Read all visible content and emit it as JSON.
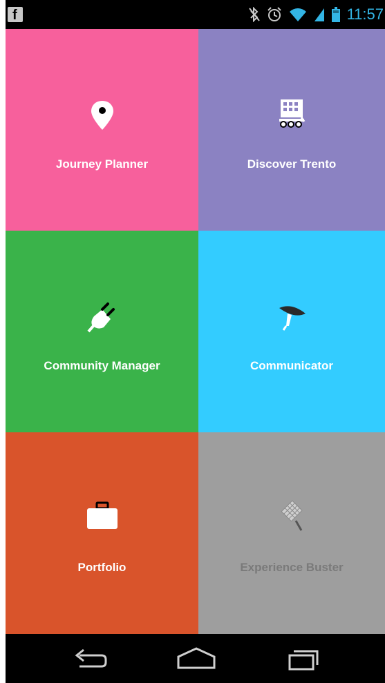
{
  "status_bar": {
    "notification_icon": "facebook-icon",
    "notification_glyph": "f",
    "icons": [
      "bluetooth-off-icon",
      "alarm-icon",
      "wifi-icon",
      "cell-signal-icon",
      "battery-icon"
    ],
    "time": "11:57",
    "accent_color": "#33b5e5"
  },
  "tiles": [
    {
      "label": "Journey Planner",
      "color": "#f7609c",
      "icon": "map-pin-icon",
      "enabled": true
    },
    {
      "label": "Discover Trento",
      "color": "#8b82c2",
      "icon": "cart-grid-icon",
      "enabled": true
    },
    {
      "label": "Community Manager",
      "color": "#3ab34a",
      "icon": "plug-icon",
      "enabled": true
    },
    {
      "label": "Communicator",
      "color": "#33ccff",
      "icon": "satellite-dish-icon",
      "enabled": true
    },
    {
      "label": "Portfolio",
      "color": "#d9542b",
      "icon": "briefcase-icon",
      "enabled": true
    },
    {
      "label": "Experience Buster",
      "color": "#9e9e9e",
      "icon": "fly-swatter-icon",
      "enabled": false
    }
  ],
  "nav_bar": {
    "buttons": [
      "back-icon",
      "home-icon",
      "recent-apps-icon"
    ]
  }
}
